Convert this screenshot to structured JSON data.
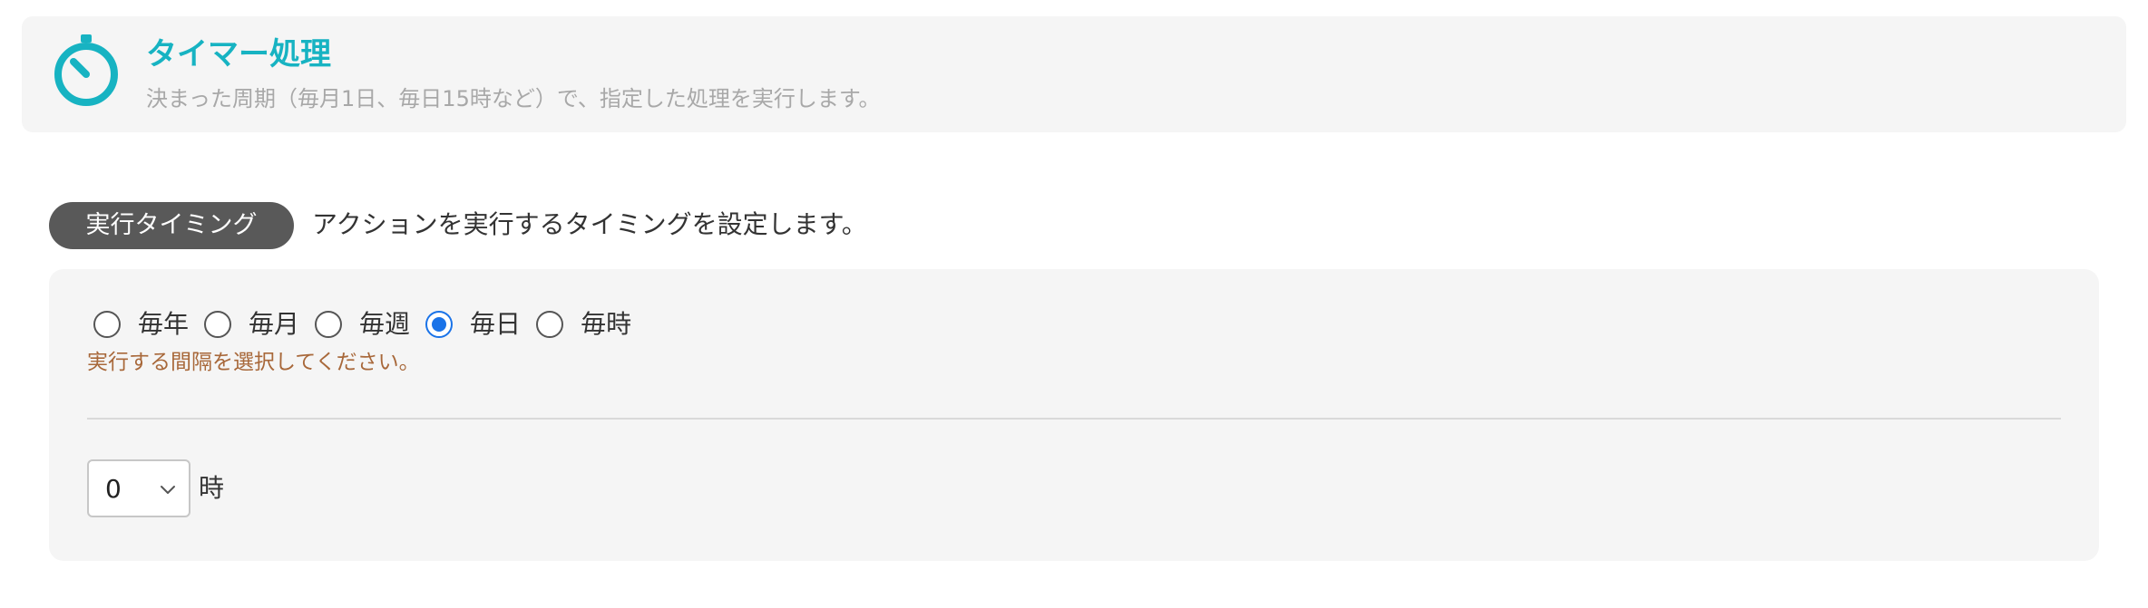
{
  "header": {
    "icon": "timer-icon",
    "title": "タイマー処理",
    "description": "決まった周期（毎月1日、毎日15時など）で、指定した処理を実行します。"
  },
  "section": {
    "label": "実行タイミング",
    "description": "アクションを実行するタイミングを設定します。"
  },
  "interval": {
    "options": [
      {
        "label": "毎年",
        "checked": false
      },
      {
        "label": "毎月",
        "checked": false
      },
      {
        "label": "毎週",
        "checked": false
      },
      {
        "label": "毎日",
        "checked": true
      },
      {
        "label": "毎時",
        "checked": false
      }
    ],
    "hint": "実行する間隔を選択してください。"
  },
  "hour": {
    "selected": "0",
    "unit": "時"
  },
  "colors": {
    "accent": "#17b3c2",
    "radio_checked": "#1a73e8",
    "hint": "#a8683a",
    "pill_bg": "#595959"
  }
}
